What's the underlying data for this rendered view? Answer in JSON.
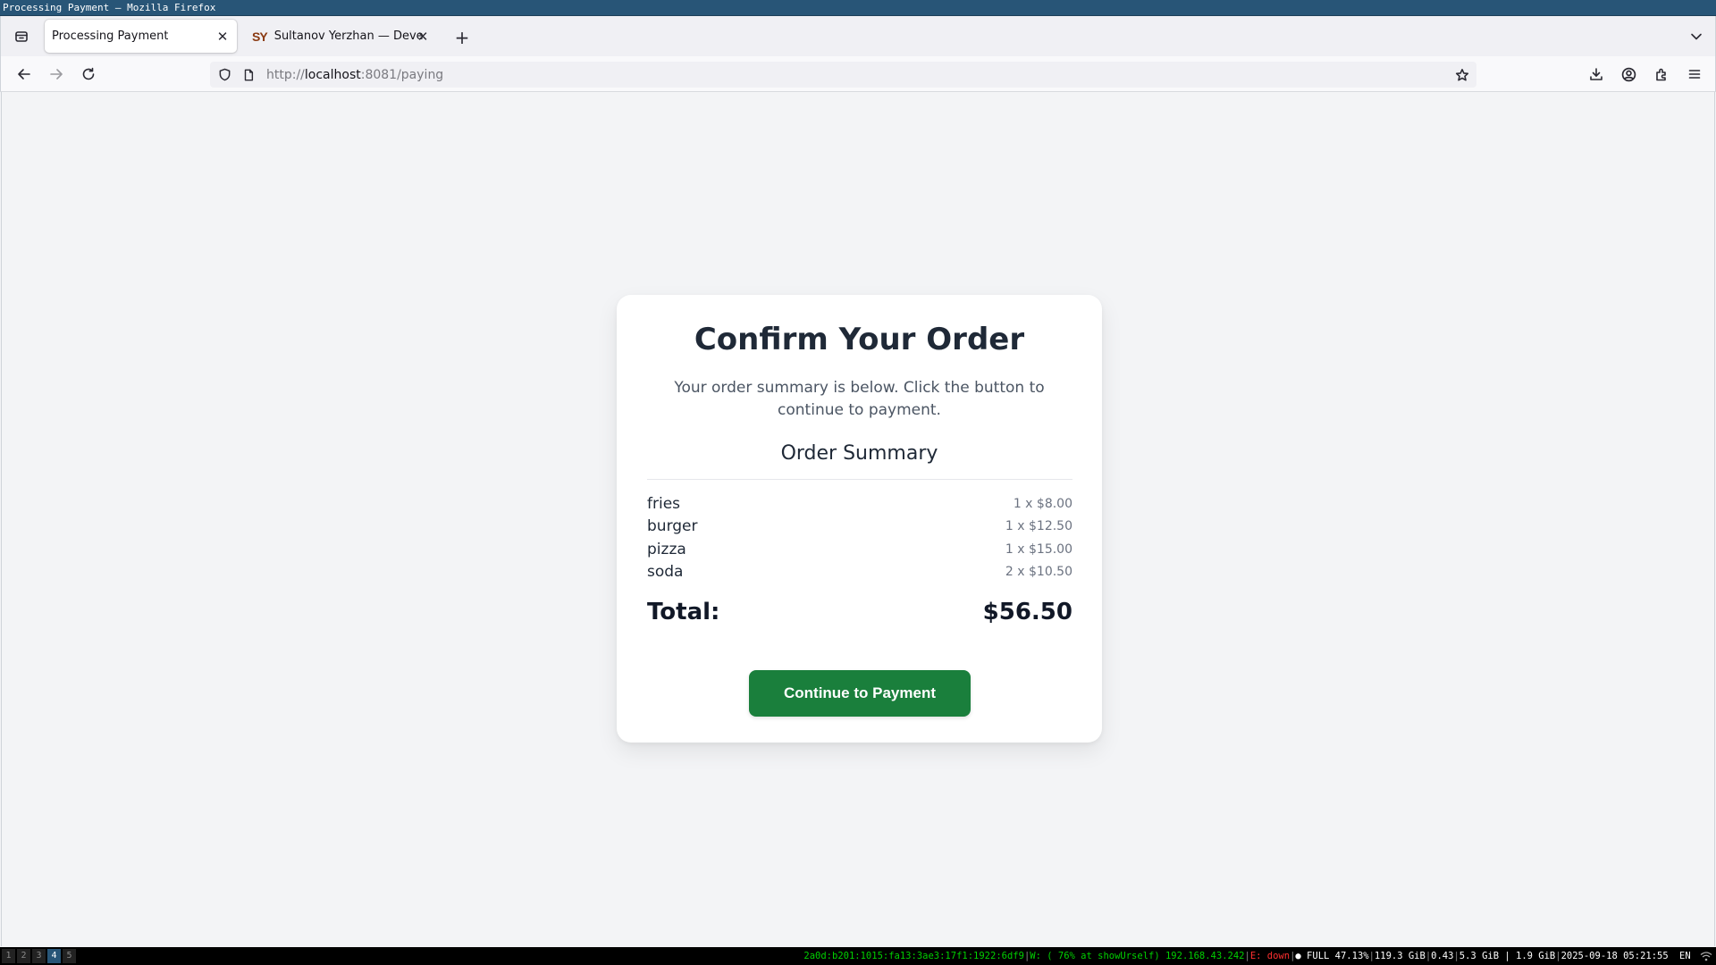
{
  "window": {
    "title": "Processing Payment — Mozilla Firefox"
  },
  "tabs": [
    {
      "label": "Processing Payment",
      "active": true
    },
    {
      "label": "Sultanov Yerzhan — Developer",
      "favicon_text": "SY",
      "active": false
    }
  ],
  "urlbar": {
    "scheme": "http://",
    "host": "localhost",
    "rest": ":8081/paying"
  },
  "page": {
    "heading": "Confirm Your Order",
    "subtitle": "Your order summary is below. Click the button to continue to payment.",
    "summary_title": "Order Summary",
    "items": [
      {
        "name": "fries",
        "qty_price": "1 x $8.00"
      },
      {
        "name": "burger",
        "qty_price": "1 x $12.50"
      },
      {
        "name": "pizza",
        "qty_price": "1 x $15.00"
      },
      {
        "name": "soda",
        "qty_price": "2 x $10.50"
      }
    ],
    "total_label": "Total:",
    "total_value": "$56.50",
    "button_label": "Continue to Payment",
    "button_color": "#1a7f3c"
  },
  "statusbar": {
    "workspaces": [
      "1",
      "2",
      "3",
      "4",
      "5"
    ],
    "active_workspace": "4",
    "ipv6": "2a0d:b201:1015:fa13:3ae3:17f1:1922:6df9",
    "wifi": "W: ( 76% at showUrself) 192.168.43.242",
    "ethernet": "E: down",
    "battery": "● FULL 47.13%",
    "disk": "119.3 GiB",
    "load": "0.43",
    "memory": "5.3 GiB | 1.9 GiB",
    "datetime": "2025-09-18 05:21:55",
    "layout": "EN"
  }
}
